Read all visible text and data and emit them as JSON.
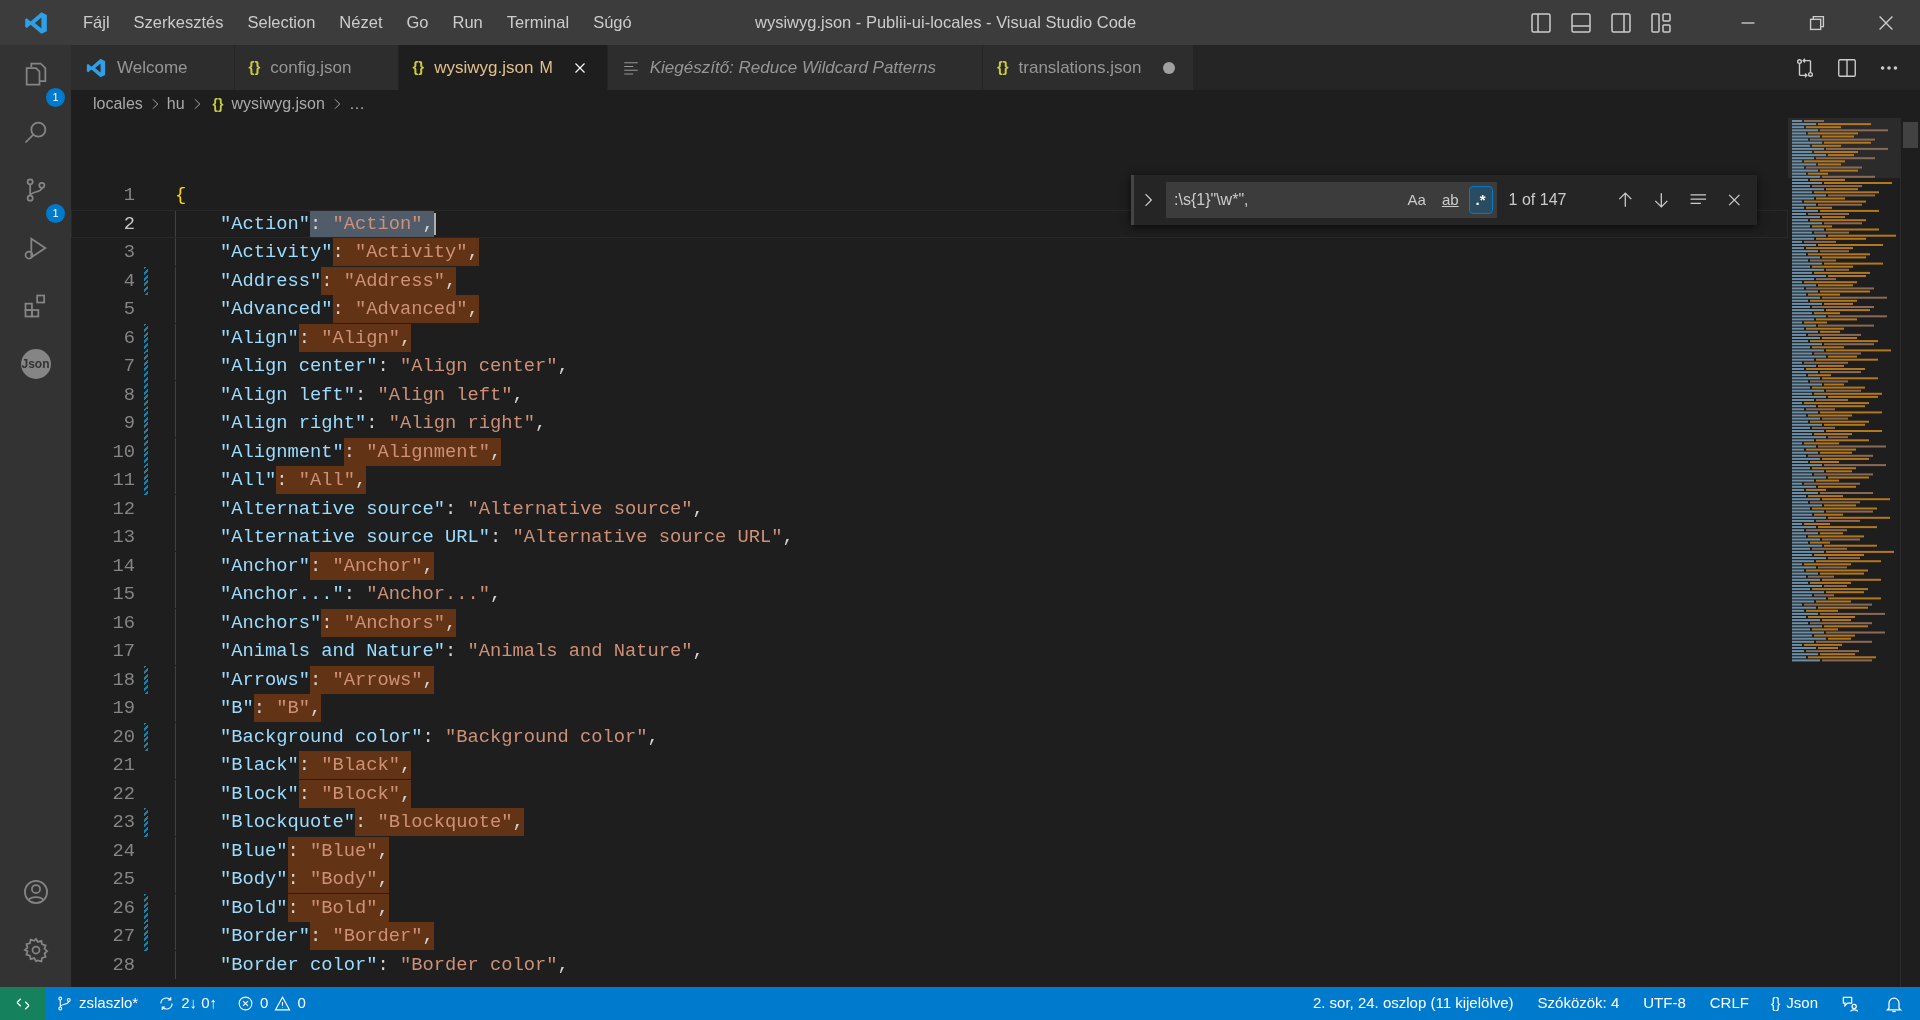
{
  "title_bar": {
    "menu": [
      "Fájl",
      "Szerkesztés",
      "Selection",
      "Nézet",
      "Go",
      "Run",
      "Terminal",
      "Súgó"
    ],
    "title": "wysiwyg.json - Publii-ui-locales - Visual Studio Code"
  },
  "activity_bar": {
    "items": [
      {
        "kind": "explorer",
        "badge": "1"
      },
      {
        "kind": "search"
      },
      {
        "kind": "scm",
        "badge": "1"
      },
      {
        "kind": "debug"
      },
      {
        "kind": "extensions"
      },
      {
        "kind": "json",
        "label": "Json"
      }
    ],
    "bottom": [
      {
        "kind": "account"
      },
      {
        "kind": "settings"
      }
    ]
  },
  "tabs": [
    {
      "kind": "welcome",
      "label": "Welcome",
      "selected": false
    },
    {
      "kind": "json",
      "icon": "{}",
      "label": "config.json",
      "selected": false
    },
    {
      "kind": "json",
      "icon": "{}",
      "label": "wysiwyg.json",
      "selected": true,
      "status": "M"
    },
    {
      "kind": "preview",
      "label": "Kiegészítő: Reduce Wildcard Patterns",
      "selected": false
    },
    {
      "kind": "json",
      "icon": "{}",
      "label": "translations.json",
      "selected": false,
      "dirty": true
    }
  ],
  "breadcrumb": [
    {
      "label": "locales"
    },
    {
      "label": "hu"
    },
    {
      "label": "wysiwyg.json",
      "icon": "{}"
    },
    {
      "label": "…"
    }
  ],
  "find": {
    "query": ":\\s{1}\"\\w*\",",
    "options": [
      {
        "label": "Aa",
        "on": false
      },
      {
        "label": "ab",
        "on": false
      },
      {
        "label": ".*",
        "on": true
      }
    ],
    "count": "1 of 147"
  },
  "lines": [
    {
      "number": "1",
      "kind": "brace",
      "text": "{",
      "modified": false
    },
    {
      "number": "2",
      "kind": "pair",
      "text": "\"Action\": \"Action\",",
      "current": true,
      "modified": false
    },
    {
      "number": "3",
      "kind": "pair",
      "text": "\"Activity\": \"Activity\",",
      "matched": true,
      "modified": false
    },
    {
      "number": "4",
      "kind": "pair",
      "text": "\"Address\": \"Address\",",
      "matched": true,
      "modified": true
    },
    {
      "number": "5",
      "kind": "pair",
      "text": "\"Advanced\": \"Advanced\",",
      "matched": true,
      "modified": false
    },
    {
      "number": "6",
      "kind": "pair",
      "text": "\"Align\": \"Align\",",
      "matched": true,
      "modified": true
    },
    {
      "number": "7",
      "kind": "pair",
      "text": "\"Align center\": \"Align center\",",
      "matched": false,
      "modified": true
    },
    {
      "number": "8",
      "kind": "pair",
      "text": "\"Align left\": \"Align left\",",
      "matched": false,
      "modified": true
    },
    {
      "number": "9",
      "kind": "pair",
      "text": "\"Align right\": \"Align right\",",
      "matched": false,
      "modified": true
    },
    {
      "number": "10",
      "kind": "pair",
      "text": "\"Alignment\": \"Alignment\",",
      "matched": true,
      "modified": true
    },
    {
      "number": "11",
      "kind": "pair",
      "text": "\"All\": \"All\",",
      "matched": true,
      "modified": true
    },
    {
      "number": "12",
      "kind": "pair",
      "text": "\"Alternative source\": \"Alternative source\",",
      "matched": false,
      "modified": false
    },
    {
      "number": "13",
      "kind": "pair",
      "text": "\"Alternative source URL\": \"Alternative source URL\",",
      "matched": false,
      "modified": false
    },
    {
      "number": "14",
      "kind": "pair",
      "text": "\"Anchor\": \"Anchor\",",
      "matched": true,
      "modified": false
    },
    {
      "number": "15",
      "kind": "pair",
      "text": "\"Anchor...\": \"Anchor...\",",
      "matched": false,
      "modified": false
    },
    {
      "number": "16",
      "kind": "pair",
      "text": "\"Anchors\": \"Anchors\",",
      "matched": true,
      "modified": false
    },
    {
      "number": "17",
      "kind": "pair",
      "text": "\"Animals and Nature\": \"Animals and Nature\",",
      "matched": false,
      "modified": false
    },
    {
      "number": "18",
      "kind": "pair",
      "text": "\"Arrows\": \"Arrows\",",
      "matched": true,
      "modified": true
    },
    {
      "number": "19",
      "kind": "pair",
      "text": "\"B\": \"B\",",
      "matched": true,
      "modified": false
    },
    {
      "number": "20",
      "kind": "pair",
      "text": "\"Background color\": \"Background color\",",
      "matched": false,
      "modified": true
    },
    {
      "number": "21",
      "kind": "pair",
      "text": "\"Black\": \"Black\",",
      "matched": true,
      "modified": false
    },
    {
      "number": "22",
      "kind": "pair",
      "text": "\"Block\": \"Block\",",
      "matched": true,
      "modified": false
    },
    {
      "number": "23",
      "kind": "pair",
      "text": "\"Blockquote\": \"Blockquote\",",
      "matched": true,
      "modified": true
    },
    {
      "number": "24",
      "kind": "pair",
      "text": "\"Blue\": \"Blue\",",
      "matched": true,
      "modified": false
    },
    {
      "number": "25",
      "kind": "pair",
      "text": "\"Body\": \"Body\",",
      "matched": true,
      "modified": false
    },
    {
      "number": "26",
      "kind": "pair",
      "text": "\"Bold\": \"Bold\",",
      "matched": true,
      "modified": true
    },
    {
      "number": "27",
      "kind": "pair",
      "text": "\"Border\": \"Border\",",
      "matched": true,
      "modified": true
    },
    {
      "number": "28",
      "kind": "pair",
      "text": "\"Border color\": \"Border color\",",
      "matched": false,
      "modified": false
    }
  ],
  "status_bar": {
    "branch": "zslaszlo*",
    "sync": "2↓ 0↑",
    "errors": "0",
    "warnings": "0",
    "position": "2. sor, 24. oszlop (11 kijelölve)",
    "indent": "Szóközök: 4",
    "encoding": "UTF-8",
    "eol": "CRLF",
    "language_icon": "{}",
    "language": "Json"
  }
}
